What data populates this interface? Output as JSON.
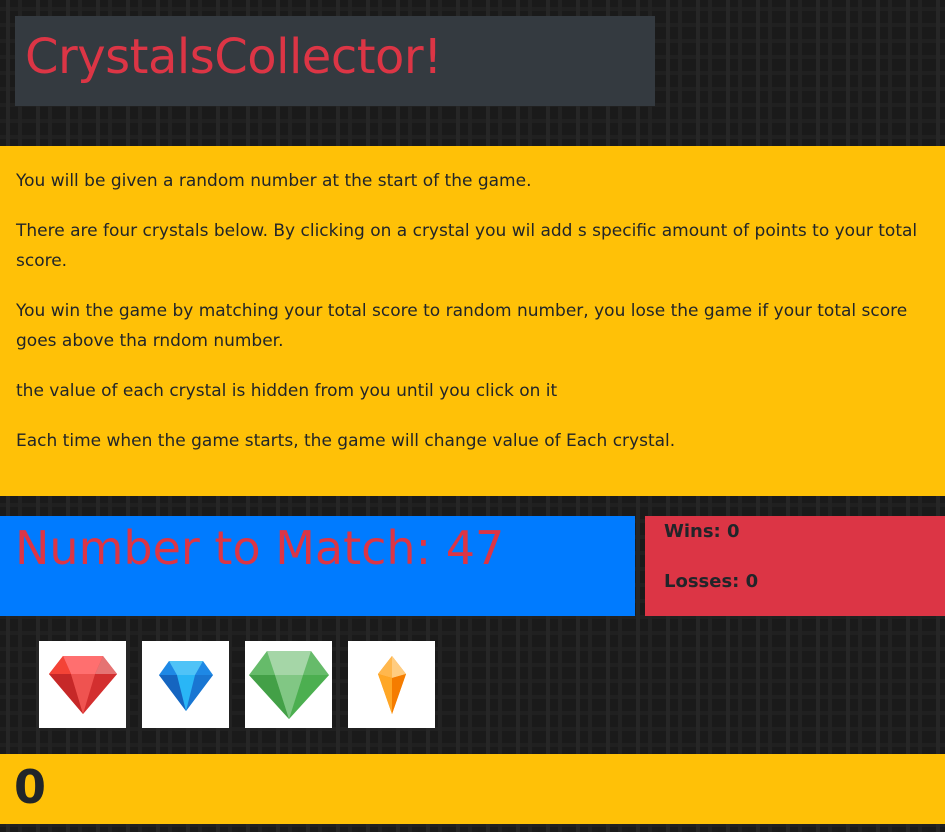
{
  "title": "CrystalsCollector!",
  "instructions": [
    "You will be given a random number at the start of the game.",
    "There are four crystals below. By clicking on a crystal you wil add s specific amount of points to your total score.",
    "You win the game by matching your total score to random number, you lose the game if your total score goes above tha rndom number.",
    "the value of each crystal is hidden from you until you click on it",
    "Each time when the game starts, the game will change value of Each crystal."
  ],
  "target": {
    "label": "Number to Match: 47"
  },
  "score": {
    "wins": "Wins: 0",
    "losses": "Losses: 0"
  },
  "crystals": [
    "red-ruby-icon",
    "blue-diamond-icon",
    "green-emerald-icon",
    "orange-crystal-icon"
  ],
  "total": "0",
  "colors": {
    "title": "#dc3545",
    "panel": "#ffc107",
    "target_bg": "#007bff",
    "score_bg": "#dc3545"
  }
}
